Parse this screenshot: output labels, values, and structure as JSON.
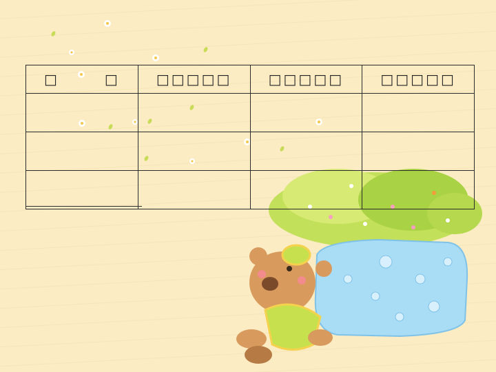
{
  "table": {
    "header": [
      "□",
      "□",
      "□□□□□",
      "□□□□□",
      "□□□□□"
    ],
    "rows": [
      [
        "",
        "",
        "",
        ""
      ],
      [
        "",
        "",
        "",
        ""
      ],
      [
        "",
        "",
        "",
        ""
      ]
    ]
  },
  "colors": {
    "background": "#fbecc4",
    "grid_line": "#2b2b2b",
    "pot": "#a9dcf5",
    "bear": "#d99a5e",
    "foliage": "#b7d94a"
  },
  "decorations": [
    "daisy-icon",
    "leaf-icon",
    "teddy-bear-illustration",
    "flower-pot-illustration"
  ]
}
